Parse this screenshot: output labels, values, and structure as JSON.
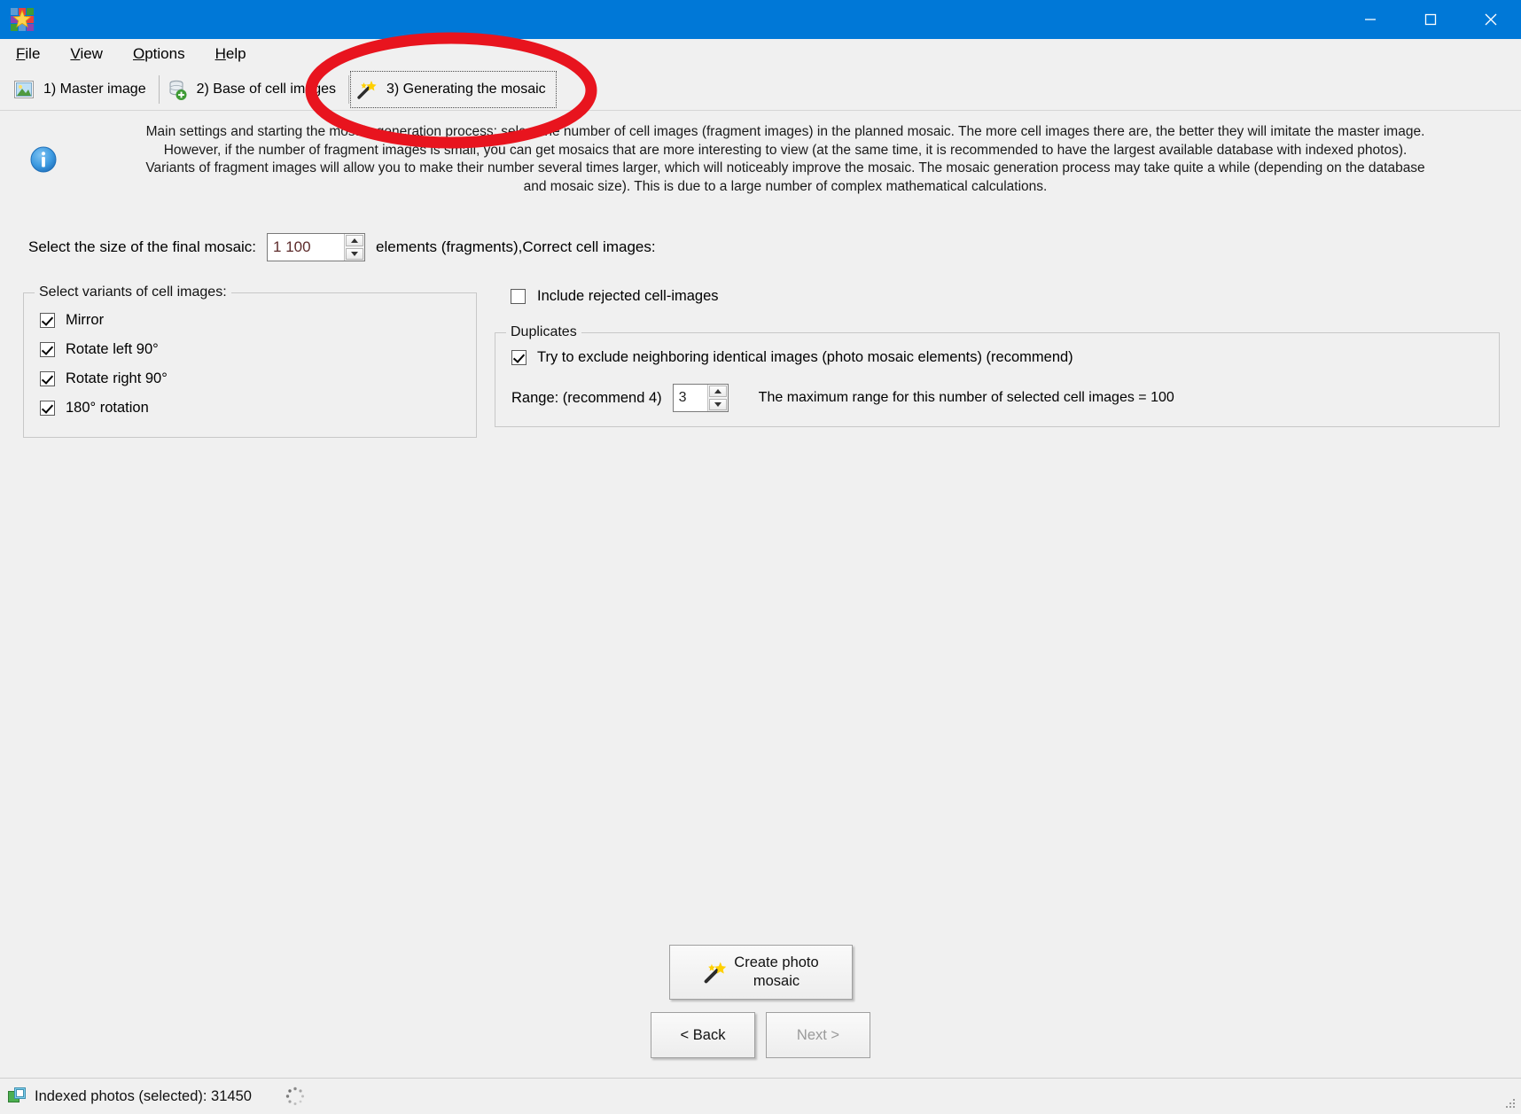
{
  "window": {
    "title": "",
    "app_icon": "mosaic-puzzle-icon",
    "controls": {
      "minimize": "minimize-icon",
      "maximize": "maximize-icon",
      "close": "close-icon"
    }
  },
  "menu": {
    "items": [
      {
        "accel": "F",
        "rest": "ile"
      },
      {
        "accel": "V",
        "rest": "iew"
      },
      {
        "accel": "O",
        "rest": "ptions"
      },
      {
        "accel": "H",
        "rest": "elp"
      }
    ]
  },
  "tabs": [
    {
      "label": "1) Master image",
      "icon": "picture-icon",
      "selected": false
    },
    {
      "label": "2) Base of cell images",
      "icon": "database-add-icon",
      "selected": false
    },
    {
      "label": "3) Generating the mosaic",
      "icon": "magic-wand-icon",
      "selected": true
    }
  ],
  "info": {
    "icon": "info-icon",
    "lines": [
      "Main settings and starting the mosaic generation process: select the number of cell images (fragment images) in the planned mosaic. The more cell images there are, the better they will imitate the master image.",
      "However, if the number of fragment images is small, you can get mosaics that are more interesting to view (at the same time, it is recommended to have the largest available database with indexed photos).",
      "Variants of fragment images will allow you to make their number several times larger, which will noticeably improve the mosaic. The mosaic generation process may take quite a while (depending on the database",
      "and mosaic size). This is due to a large number of complex mathematical calculations."
    ]
  },
  "size_row": {
    "label": "Select the size of the final mosaic:",
    "value": "1 100",
    "suffix": "elements (fragments),Correct cell images:"
  },
  "variants_group": {
    "legend": "Select variants of cell images:",
    "options": [
      {
        "label": "Mirror",
        "checked": true
      },
      {
        "label": "Rotate left 90°",
        "checked": true
      },
      {
        "label": "Rotate right 90°",
        "checked": true
      },
      {
        "label": "180° rotation",
        "checked": true
      }
    ]
  },
  "rejected": {
    "label": "Include rejected cell-images",
    "checked": false
  },
  "duplicates_group": {
    "legend": "Duplicates",
    "exclude": {
      "label": "Try to exclude neighboring identical images (photo mosaic elements) (recommend)",
      "checked": true
    },
    "range": {
      "label": "Range: (recommend 4)",
      "value": "3",
      "note": "The maximum range for this number of selected cell images = 100"
    }
  },
  "buttons": {
    "create": {
      "line1": "Create photo",
      "line2": "mosaic",
      "icon": "magic-wand-icon"
    },
    "back": "< Back",
    "next": "Next >",
    "next_disabled": true
  },
  "statusbar": {
    "icon": "indexed-photos-icon",
    "text": "Indexed photos (selected): 31450",
    "busy_indicator": "loading-spinner-icon",
    "resize_grip": "resize-grip-icon"
  },
  "annotation": {
    "shape": "ellipse",
    "color": "#e8141e",
    "target": "tab-generating-the-mosaic"
  },
  "colors": {
    "titlebar": "#0078d7",
    "window_bg": "#f0f0f0",
    "accent_red": "#e8141e",
    "value_text": "#5d2b2b"
  }
}
